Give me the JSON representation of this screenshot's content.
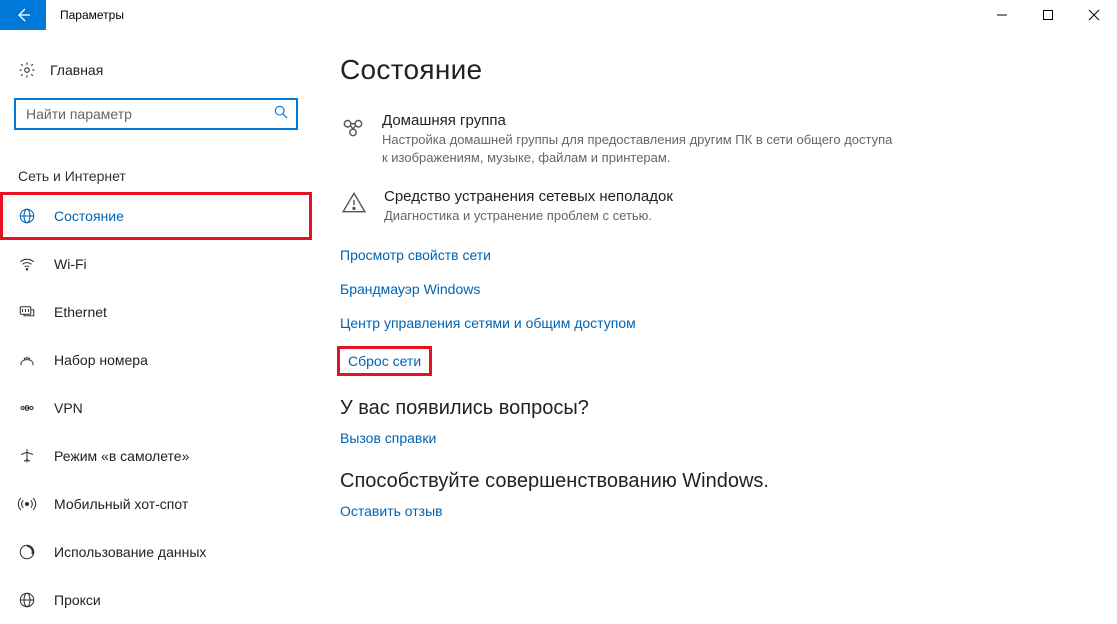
{
  "window": {
    "title": "Параметры"
  },
  "sidebar": {
    "home": "Главная",
    "search_placeholder": "Найти параметр",
    "group": "Сеть и Интернет",
    "items": [
      {
        "label": "Состояние"
      },
      {
        "label": "Wi-Fi"
      },
      {
        "label": "Ethernet"
      },
      {
        "label": "Набор номера"
      },
      {
        "label": "VPN"
      },
      {
        "label": "Режим «в самолете»"
      },
      {
        "label": "Мобильный хот-спот"
      },
      {
        "label": "Использование данных"
      },
      {
        "label": "Прокси"
      }
    ]
  },
  "content": {
    "title": "Состояние",
    "sections": [
      {
        "title": "Домашняя группа",
        "sub": "Настройка домашней группы для предоставления другим ПК в сети общего доступа к изображениям, музыке, файлам и принтерам."
      },
      {
        "title": "Средство устранения сетевых неполадок",
        "sub": "Диагностика и устранение проблем с сетью."
      }
    ],
    "links": [
      "Просмотр свойств сети",
      "Брандмауэр Windows",
      "Центр управления сетями и общим доступом",
      "Сброс сети"
    ],
    "qa_heading": "У вас появились вопросы?",
    "help_link": "Вызов справки",
    "improve_heading": "Способствуйте совершенствованию Windows.",
    "feedback_link": "Оставить отзыв"
  }
}
